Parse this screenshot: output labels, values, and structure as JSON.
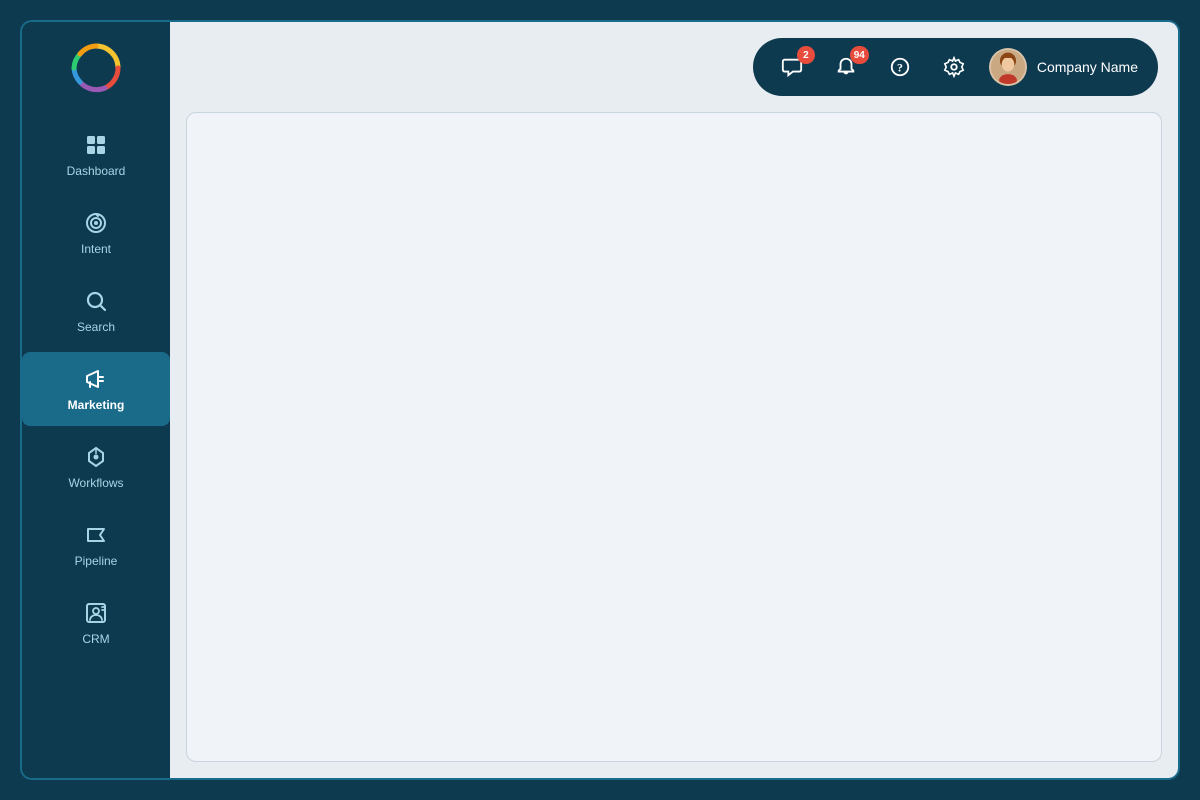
{
  "sidebar": {
    "items": [
      {
        "id": "dashboard",
        "label": "Dashboard",
        "active": false
      },
      {
        "id": "intent",
        "label": "Intent",
        "active": false
      },
      {
        "id": "search",
        "label": "Search",
        "active": false
      },
      {
        "id": "marketing",
        "label": "Marketing",
        "active": true
      },
      {
        "id": "workflows",
        "label": "Workflows",
        "active": false
      },
      {
        "id": "pipeline",
        "label": "Pipeline",
        "active": false
      },
      {
        "id": "crm",
        "label": "CRM",
        "active": false
      }
    ]
  },
  "header": {
    "messages_badge": "2",
    "notifications_badge": "94",
    "company_name": "Company Name"
  },
  "colors": {
    "sidebar_bg": "#0d3a4f",
    "active_item": "#1a6a8a",
    "badge_red": "#e74c3c"
  }
}
